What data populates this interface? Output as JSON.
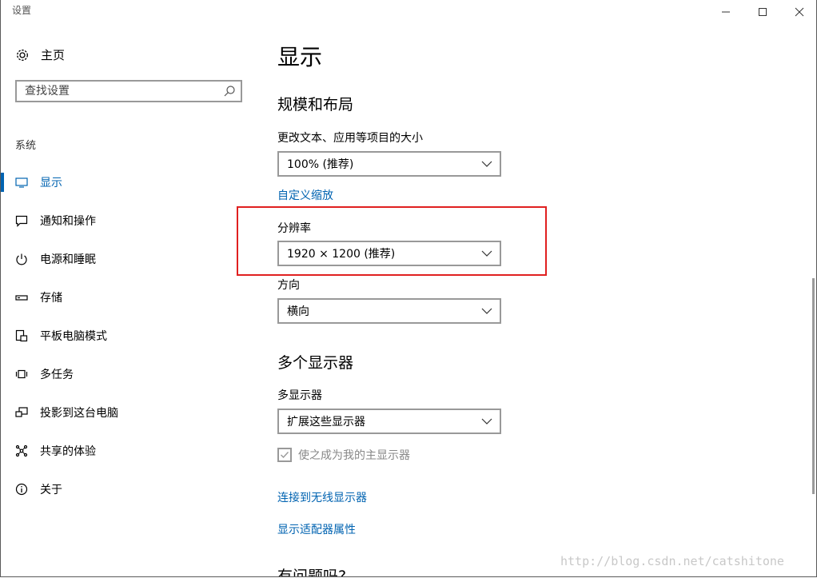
{
  "app": {
    "title": "设置",
    "minimize_glyph": "—",
    "maximize_glyph": "☐",
    "close_glyph": "✕"
  },
  "sidebar": {
    "home_label": "主页",
    "search_placeholder": "查找设置",
    "group_label": "系统",
    "items": [
      {
        "label": "显示",
        "icon": "monitor-icon",
        "active": true
      },
      {
        "label": "通知和操作",
        "icon": "notification-icon",
        "active": false
      },
      {
        "label": "电源和睡眠",
        "icon": "power-icon",
        "active": false
      },
      {
        "label": "存储",
        "icon": "storage-icon",
        "active": false
      },
      {
        "label": "平板电脑模式",
        "icon": "tablet-icon",
        "active": false
      },
      {
        "label": "多任务",
        "icon": "multitask-icon",
        "active": false
      },
      {
        "label": "投影到这台电脑",
        "icon": "project-icon",
        "active": false
      },
      {
        "label": "共享的体验",
        "icon": "share-icon",
        "active": false
      },
      {
        "label": "关于",
        "icon": "info-icon",
        "active": false
      }
    ]
  },
  "main": {
    "title": "显示",
    "scale_section_title": "规模和布局",
    "scale_label": "更改文本、应用等项目的大小",
    "scale_value": "100% (推荐)",
    "custom_scale_link": "自定义缩放",
    "resolution_label": "分辨率",
    "resolution_value": "1920 × 1200 (推荐)",
    "orientation_label": "方向",
    "orientation_value": "横向",
    "multi_section_title": "多个显示器",
    "multi_label": "多显示器",
    "multi_value": "扩展这些显示器",
    "primary_checkbox_label": "使之成为我的主显示器",
    "primary_checked": true,
    "wireless_link": "连接到无线显示器",
    "adapter_link": "显示适配器属性",
    "question_title": "有问题吗?"
  },
  "watermark": "http://blog.csdn.net/catshitone",
  "colors": {
    "accent": "#0063b1",
    "highlight_border": "#e02020"
  }
}
